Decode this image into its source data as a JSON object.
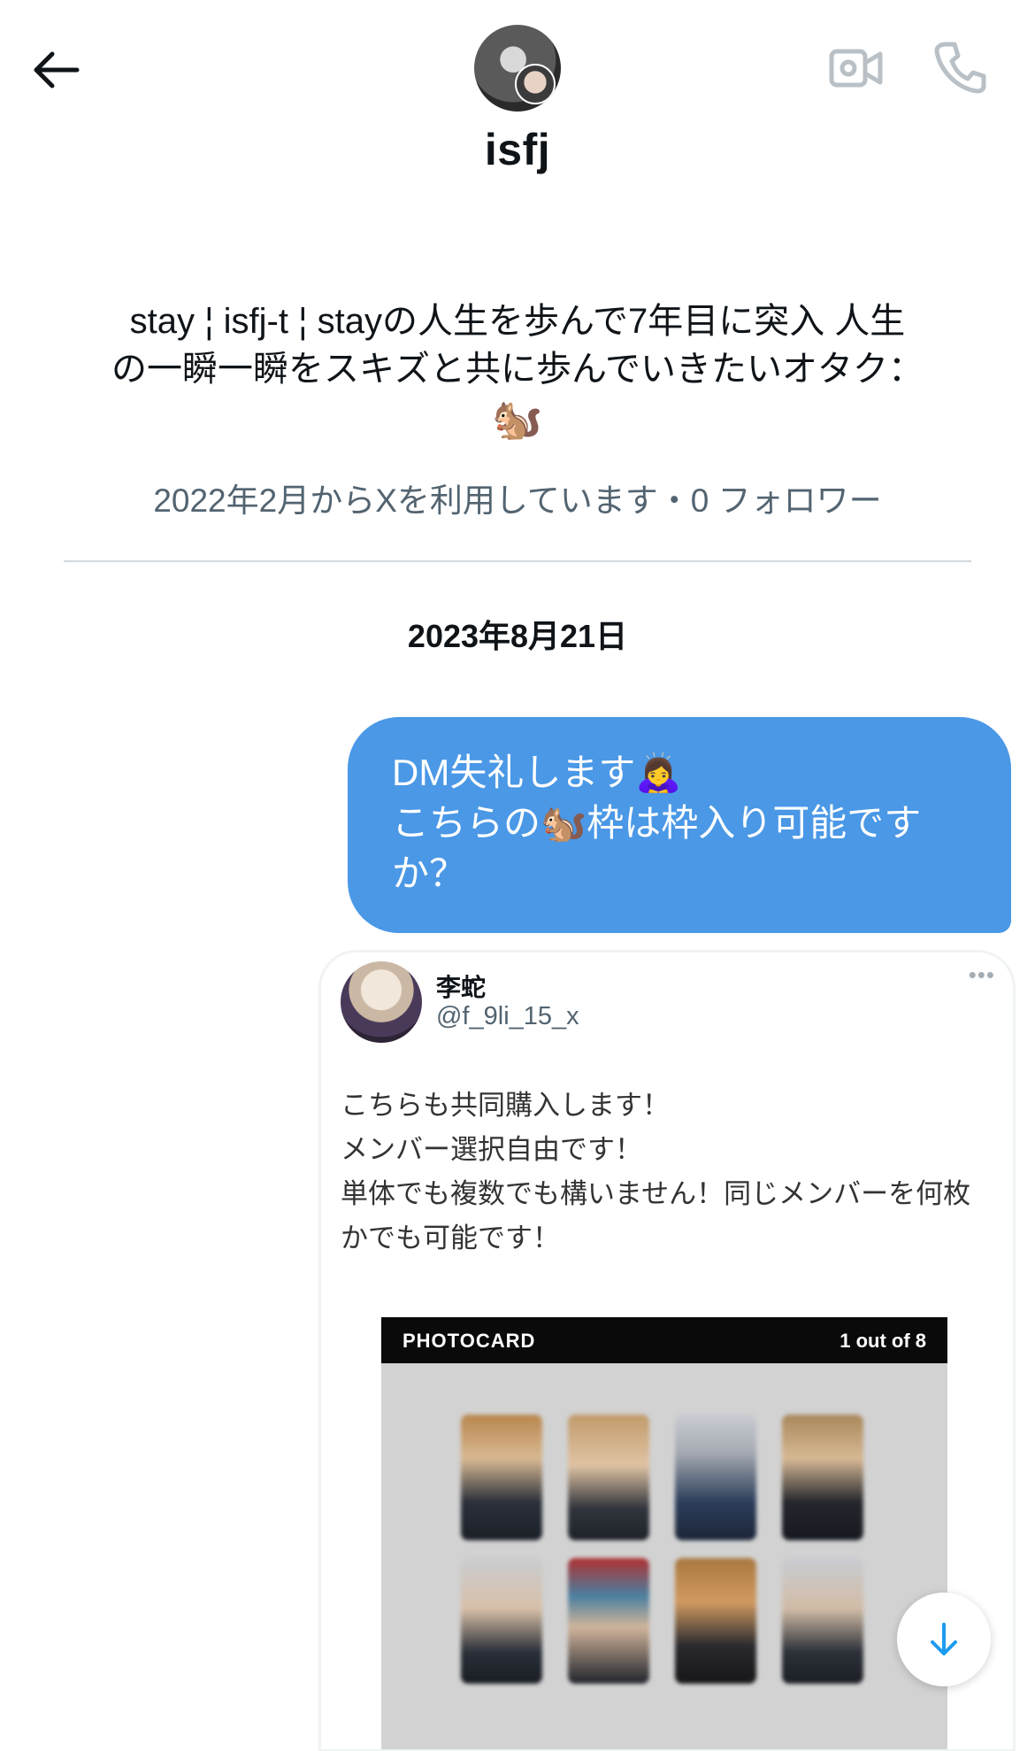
{
  "header": {
    "name": "isfj",
    "icons": [
      "back-arrow-icon",
      "video-camera-icon",
      "phone-icon"
    ]
  },
  "profile": {
    "bio_line1": "stay ¦ isfj-t ¦ stayの人生を歩んで7年目に突入 人生",
    "bio_line2": "の一瞬一瞬をスキズと共に歩んでいきたいオタク：",
    "bio_emoji": "🐿️",
    "joined": "2022年2月からXを利用しています・0 フォロワー"
  },
  "conversation": {
    "date": "2023年8月21日",
    "message": {
      "line1": "DM失礼します🙇‍♀️",
      "line2": "こちらの🐿️枠は枠入り可能です",
      "line3": "か？"
    },
    "shared_tweet": {
      "author": "李蛇",
      "handle": "@f_9li_15_x",
      "more": "•••",
      "text_lines": [
        "こちらも共同購入します！",
        "メンバー選択自由です！",
        "単体でも複数でも構いません！同じメンバーを何枚",
        "かでも可能です！"
      ],
      "image": {
        "title": "PHOTOCARD",
        "counter": "1 out of 8"
      }
    }
  },
  "colors": {
    "bubble": "#4a98e6",
    "secondary_text": "#536471",
    "divider": "#cfd9de",
    "accent": "#1d9bf0"
  }
}
